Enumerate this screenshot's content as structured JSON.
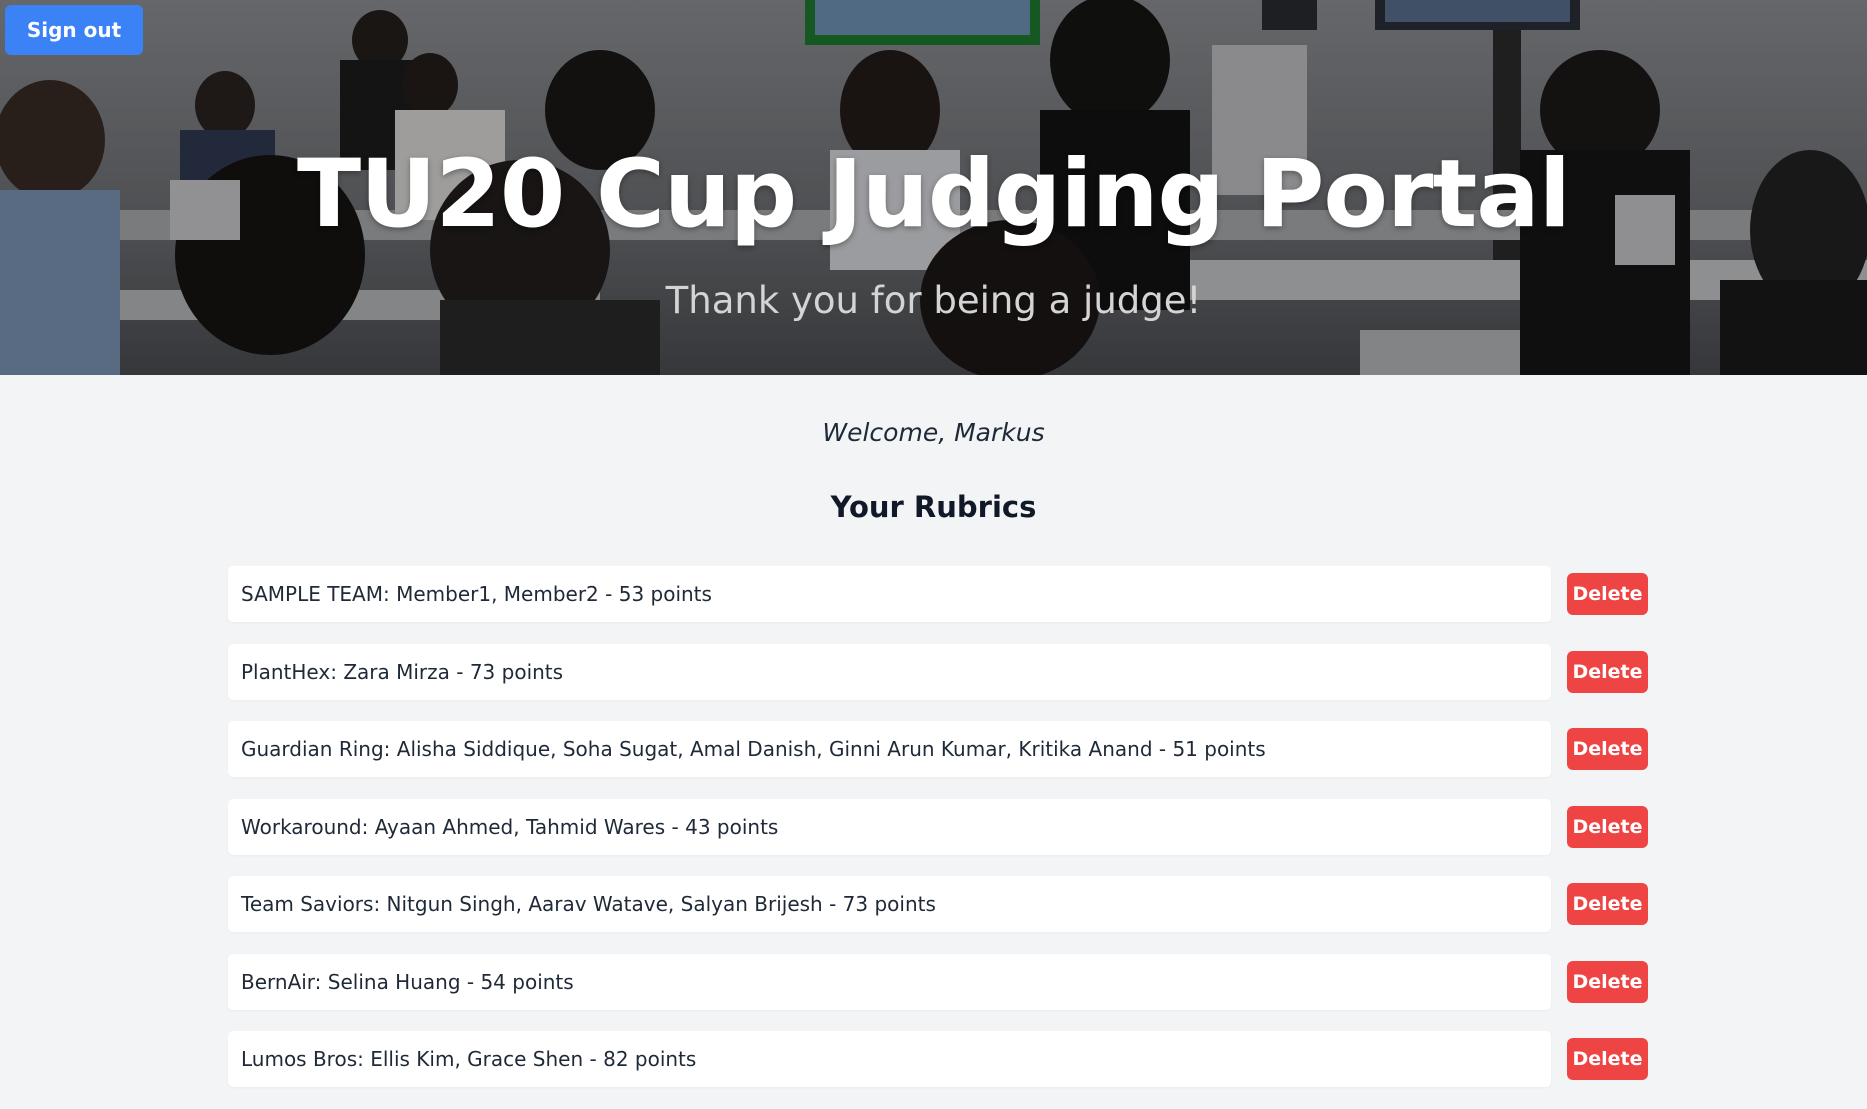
{
  "header": {
    "signout_label": "Sign out",
    "title": "TU20 Cup Judging Portal",
    "subtitle": "Thank you for being a judge!"
  },
  "main": {
    "welcome": "Welcome, Markus",
    "rubrics_heading": "Your Rubrics",
    "delete_label": "Delete",
    "rubrics": [
      {
        "label": "SAMPLE TEAM: Member1, Member2 - 53 points"
      },
      {
        "label": "PlantHex: Zara Mirza - 73 points"
      },
      {
        "label": "Guardian Ring: Alisha Siddique, Soha Sugat, Amal Danish, Ginni Arun Kumar, Kritika Anand - 51 points"
      },
      {
        "label": "Workaround: Ayaan Ahmed, Tahmid Wares - 43 points"
      },
      {
        "label": "Team Saviors: Nitgun Singh, Aarav Watave, Salyan Brijesh - 73 points"
      },
      {
        "label": "BernAir: Selina Huang - 54 points"
      },
      {
        "label": "Lumos Bros: Ellis Kim, Grace Shen - 82 points"
      }
    ]
  },
  "colors": {
    "signout_button": "#3b82f6",
    "delete_button": "#ef4444",
    "page_background": "#f3f4f6",
    "card_background": "#ffffff"
  }
}
